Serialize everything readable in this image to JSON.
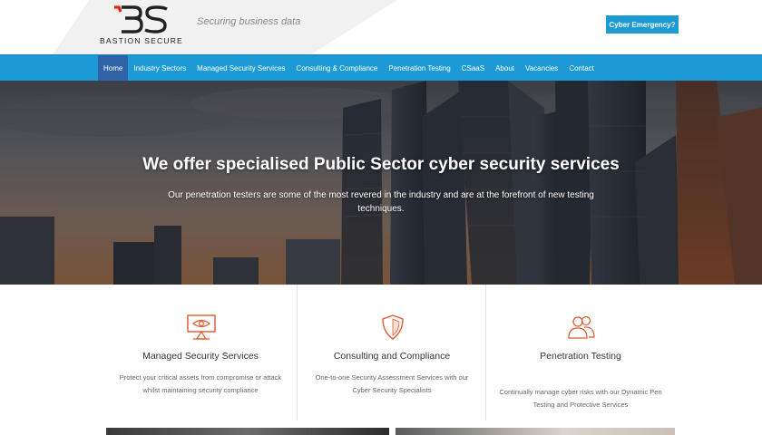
{
  "header": {
    "logo_text": "BASTION SECURE",
    "tagline": "Securing business data",
    "cta_label": "Cyber Emergency?"
  },
  "nav": {
    "items": [
      {
        "label": "Home",
        "active": true
      },
      {
        "label": "Industry Sectors"
      },
      {
        "label": "Managed Security Services"
      },
      {
        "label": "Consulting & Compliance"
      },
      {
        "label": "Penetration Testing"
      },
      {
        "label": "CSaaS"
      },
      {
        "label": "About"
      },
      {
        "label": "Vacancies"
      },
      {
        "label": "Contact"
      }
    ]
  },
  "hero": {
    "title": "We offer specialised Public Sector cyber security services",
    "subtitle": "Our penetration testers are some of the most revered in the industry and are at the forefront of new testing techniques."
  },
  "services": [
    {
      "icon": "monitor-eye-icon",
      "title": "Managed Security Services",
      "description": "Protect your critical assets from compromise or attack whilst maintaining security compliance"
    },
    {
      "icon": "shield-icon",
      "title": "Consulting and Compliance",
      "description": "One-to-one Security Assessment Services with our Cyber Security Specialists"
    },
    {
      "icon": "users-icon",
      "title": "Penetration Testing",
      "description": "Continually manage cyber risks with our Dynamic Pen Testing and Protective Services"
    }
  ],
  "colors": {
    "brand_blue": "#1b9ad6",
    "nav_active": "#2f64a8",
    "icon_orange": "#e2582c"
  }
}
